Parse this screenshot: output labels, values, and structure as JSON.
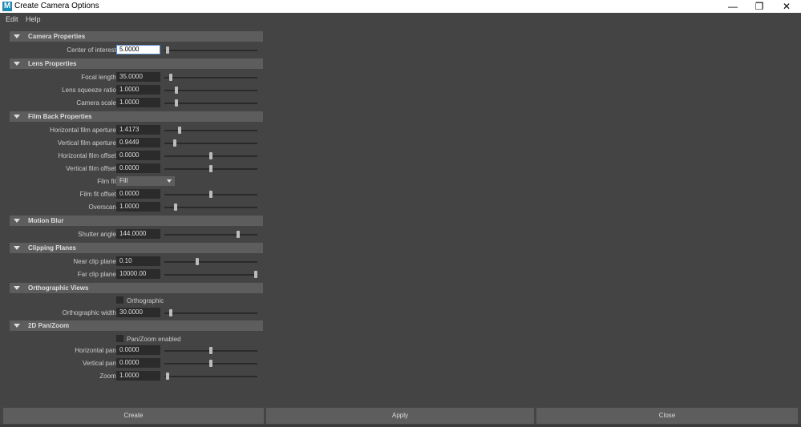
{
  "window": {
    "title": "Create Camera Options",
    "app_icon": "M",
    "controls": {
      "minimize": "—",
      "maximize": "❐",
      "close": "✕"
    }
  },
  "menu": [
    "Edit",
    "Help"
  ],
  "sections": {
    "camera_properties": {
      "title": "Camera Properties",
      "center_of_interest": {
        "label": "Center of interest:",
        "value": "5.0000"
      }
    },
    "lens_properties": {
      "title": "Lens Properties",
      "focal_length": {
        "label": "Focal length:",
        "value": "35.0000"
      },
      "lens_squeeze_ratio": {
        "label": "Lens squeeze ratio:",
        "value": "1.0000"
      },
      "camera_scale": {
        "label": "Camera scale:",
        "value": "1.0000"
      }
    },
    "film_back": {
      "title": "Film Back Properties",
      "h_aperture": {
        "label": "Horizontal film aperture:",
        "value": "1.4173"
      },
      "v_aperture": {
        "label": "Vertical film aperture:",
        "value": "0.9449"
      },
      "h_offset": {
        "label": "Horizontal film offset:",
        "value": "0.0000"
      },
      "v_offset": {
        "label": "Vertical film offset:",
        "value": "0.0000"
      },
      "film_fit": {
        "label": "Film fit:",
        "value": "Fill"
      },
      "film_fit_offset": {
        "label": "Film fit offset:",
        "value": "0.0000"
      },
      "overscan": {
        "label": "Overscan:",
        "value": "1.0000"
      }
    },
    "motion_blur": {
      "title": "Motion Blur",
      "shutter_angle": {
        "label": "Shutter angle:",
        "value": "144.0000"
      }
    },
    "clipping_planes": {
      "title": "Clipping Planes",
      "near_clip": {
        "label": "Near clip plane:",
        "value": "0.10"
      },
      "far_clip": {
        "label": "Far clip plane:",
        "value": "10000.00"
      }
    },
    "orthographic": {
      "title": "Orthographic Views",
      "checkbox_label": "Orthographic",
      "checked": false,
      "width": {
        "label": "Orthographic width:",
        "value": "30.0000"
      }
    },
    "pan_zoom": {
      "title": "2D Pan/Zoom",
      "checkbox_label": "Pan/Zoom enabled",
      "checked": false,
      "h_pan": {
        "label": "Horizontal pan:",
        "value": "0.0000"
      },
      "v_pan": {
        "label": "Vertical pan:",
        "value": "0.0000"
      },
      "zoom": {
        "label": "Zoom:",
        "value": "1.0000"
      }
    }
  },
  "slider_positions": {
    "center_of_interest": 0.02,
    "focal_length": 0.05,
    "lens_squeeze_ratio": 0.12,
    "camera_scale": 0.12,
    "h_aperture": 0.15,
    "v_aperture": 0.1,
    "h_offset": 0.5,
    "v_offset": 0.5,
    "film_fit_offset": 0.5,
    "overscan": 0.11,
    "shutter_angle": 0.8,
    "near_clip": 0.35,
    "far_clip": 1.0,
    "ortho_width": 0.05,
    "h_pan": 0.5,
    "v_pan": 0.5,
    "zoom": 0.02
  },
  "buttons": {
    "create": "Create",
    "apply": "Apply",
    "close": "Close"
  },
  "colors": {
    "background": "#444444",
    "section_header": "#5d5d5d",
    "field": "#2b2b2b",
    "button": "#5d5d5d",
    "app_icon": "#1d8bb5"
  }
}
